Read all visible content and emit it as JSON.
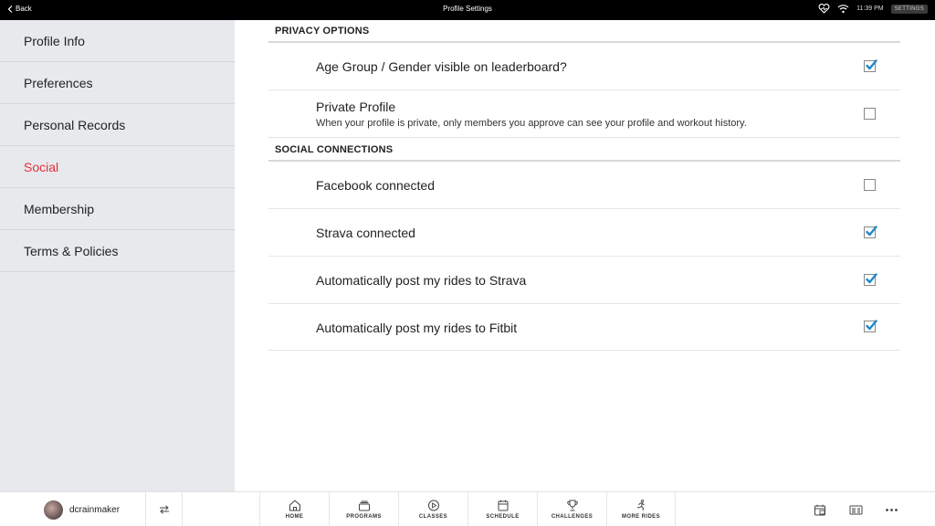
{
  "topbar": {
    "back_label": "Back",
    "title": "Profile Settings",
    "time": "11:39 PM",
    "settings_label": "SETTINGS"
  },
  "sidebar": {
    "items": [
      {
        "label": "Profile Info",
        "active": false
      },
      {
        "label": "Preferences",
        "active": false
      },
      {
        "label": "Personal Records",
        "active": false
      },
      {
        "label": "Social",
        "active": true
      },
      {
        "label": "Membership",
        "active": false
      },
      {
        "label": "Terms & Policies",
        "active": false
      }
    ]
  },
  "privacy": {
    "header": "PRIVACY OPTIONS",
    "age_group": {
      "label": "Age Group / Gender visible on leaderboard?",
      "checked": true
    },
    "private_profile": {
      "label": "Private Profile",
      "description": "When your profile is private, only members you approve can see your profile and workout history.",
      "checked": false
    }
  },
  "social": {
    "header": "SOCIAL CONNECTIONS",
    "facebook": {
      "label": "Facebook connected",
      "checked": false
    },
    "strava": {
      "label": "Strava connected",
      "checked": true
    },
    "auto_strava": {
      "label": "Automatically post my rides to Strava",
      "checked": true
    },
    "auto_fitbit": {
      "label": "Automatically post my rides to Fitbit",
      "checked": true
    }
  },
  "bottombar": {
    "username": "dcrainmaker",
    "nav": {
      "home": "HOME",
      "programs": "PROGRAMS",
      "classes": "CLASSES",
      "schedule": "SCHEDULE",
      "challenges": "CHALLENGES",
      "more_rides": "MORE RIDES"
    }
  },
  "colors": {
    "accent_red": "#e0323c",
    "checkbox_blue": "#1e88c7",
    "sidebar_bg": "#e7e9ed"
  }
}
